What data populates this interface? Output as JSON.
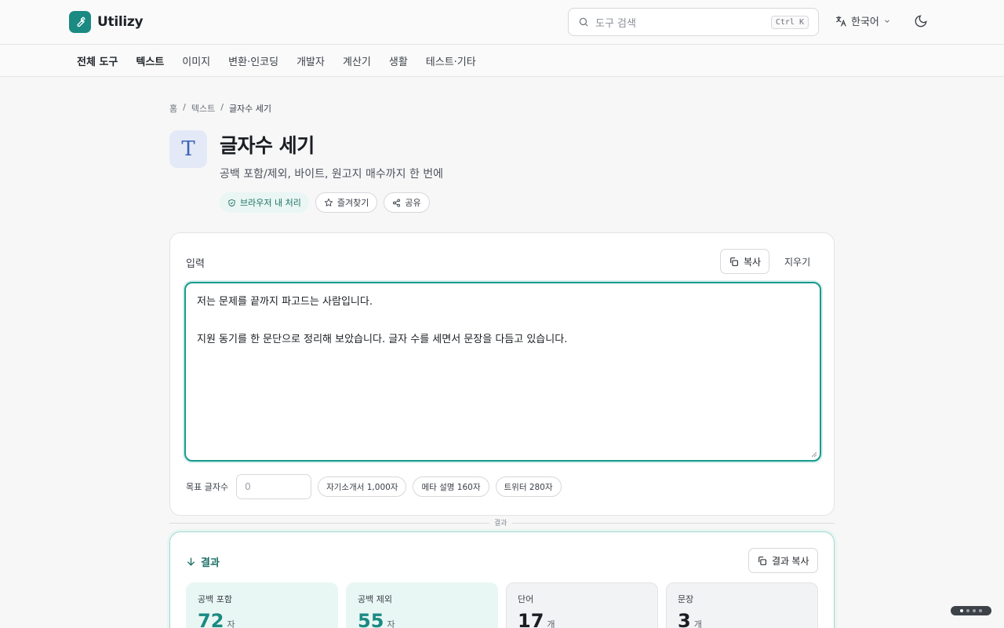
{
  "header": {
    "brand": "Utilizy",
    "search_placeholder": "도구 검색",
    "search_shortcut": "Ctrl K",
    "language": "한국어"
  },
  "nav": {
    "items": [
      {
        "label": "전체 도구",
        "active": true
      },
      {
        "label": "텍스트",
        "active": true
      },
      {
        "label": "이미지",
        "active": false
      },
      {
        "label": "변환·인코딩",
        "active": false
      },
      {
        "label": "개발자",
        "active": false
      },
      {
        "label": "계산기",
        "active": false
      },
      {
        "label": "생활",
        "active": false
      },
      {
        "label": "테스트·기타",
        "active": false
      }
    ]
  },
  "breadcrumb": {
    "home": "홈",
    "category": "텍스트",
    "current": "글자수 세기"
  },
  "tool": {
    "icon_letter": "T",
    "title": "글자수 세기",
    "subtitle": "공백 포함/제외, 바이트, 원고지 매수까지 한 번에",
    "badge_local": "브라우저 내 처리",
    "favorite_label": "즐겨찾기",
    "share_label": "공유"
  },
  "input": {
    "label": "입력",
    "copy_label": "복사",
    "clear_label": "지우기",
    "text": "저는 문제를 끝까지 파고드는 사람입니다.\n\n지원 동기를 한 문단으로 정리해 보았습니다. 글자 수를 세면서 문장을 다듬고 있습니다.",
    "target_label": "목표 글자수",
    "target_placeholder": "0",
    "presets": [
      "자기소개서 1,000자",
      "메타 설명 160자",
      "트위터 280자"
    ]
  },
  "divider_label": "결과",
  "result": {
    "title": "결과",
    "copy_label": "결과 복사",
    "stats": [
      {
        "label": "공백 포함",
        "value": "72",
        "unit": "자",
        "accent": true
      },
      {
        "label": "공백 제외",
        "value": "55",
        "unit": "자",
        "accent": true
      },
      {
        "label": "단어",
        "value": "17",
        "unit": "개",
        "accent": false
      },
      {
        "label": "문장",
        "value": "3",
        "unit": "개",
        "accent": false
      }
    ]
  },
  "colors": {
    "brand": "#1a8a82",
    "accent_border": "#1a9a8e",
    "tool_icon_bg": "#e3e9f6"
  }
}
